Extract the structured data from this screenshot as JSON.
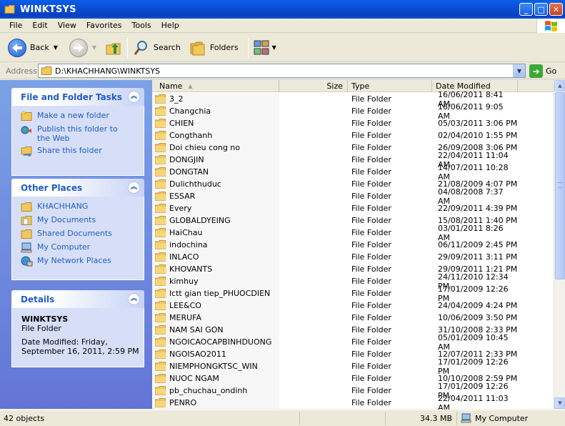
{
  "window": {
    "title": "WINKTSYS",
    "buttons": {
      "minimize": "_",
      "maximize": "□",
      "close": "✕"
    }
  },
  "menu": {
    "items": [
      "File",
      "Edit",
      "View",
      "Favorites",
      "Tools",
      "Help"
    ]
  },
  "toolbar": {
    "back_label": "Back",
    "search_label": "Search",
    "folders_label": "Folders"
  },
  "address": {
    "label": "Address",
    "value": "D:\\KHACHHANG\\WINKTSYS",
    "go_label": "Go"
  },
  "left_pane": {
    "file_tasks": {
      "title": "File and Folder Tasks",
      "items": [
        {
          "label": "Make a new folder",
          "icon": "new-folder-icon"
        },
        {
          "label": "Publish this folder to the Web",
          "icon": "publish-web-icon"
        },
        {
          "label": "Share this folder",
          "icon": "share-folder-icon"
        }
      ]
    },
    "other_places": {
      "title": "Other Places",
      "items": [
        {
          "label": "KHACHHANG",
          "icon": "folder-icon"
        },
        {
          "label": "My Documents",
          "icon": "my-documents-icon"
        },
        {
          "label": "Shared Documents",
          "icon": "shared-documents-icon"
        },
        {
          "label": "My Computer",
          "icon": "my-computer-icon"
        },
        {
          "label": "My Network Places",
          "icon": "network-places-icon"
        }
      ]
    },
    "details": {
      "title": "Details",
      "name": "WINKTSYS",
      "type": "File Folder",
      "modified_line1": "Date Modified: Friday,",
      "modified_line2": "September 16, 2011, 2:59 PM"
    }
  },
  "columns": {
    "name": "Name",
    "size": "Size",
    "type": "Type",
    "date": "Date Modified"
  },
  "files": [
    {
      "name": "3_2",
      "type": "File Folder",
      "date": "16/06/2011 8:41 AM"
    },
    {
      "name": "Changchia",
      "type": "File Folder",
      "date": "16/06/2011 9:05 AM"
    },
    {
      "name": "CHIEN",
      "type": "File Folder",
      "date": "05/03/2011 3:06 PM"
    },
    {
      "name": "Congthanh",
      "type": "File Folder",
      "date": "02/04/2010 1:55 PM"
    },
    {
      "name": "Doi chieu cong no",
      "type": "File Folder",
      "date": "26/09/2008 3:06 PM"
    },
    {
      "name": "DONGJIN",
      "type": "File Folder",
      "date": "22/04/2011 11:04 AM"
    },
    {
      "name": "DONGTAN",
      "type": "File Folder",
      "date": "14/07/2011 10:28 AM"
    },
    {
      "name": "Dulichthuduc",
      "type": "File Folder",
      "date": "21/08/2009 4:07 PM"
    },
    {
      "name": "ESSAR",
      "type": "File Folder",
      "date": "04/08/2008 7:37 AM"
    },
    {
      "name": "Every",
      "type": "File Folder",
      "date": "22/09/2011 4:39 PM"
    },
    {
      "name": "GLOBALDYEING",
      "type": "File Folder",
      "date": "15/08/2011 1:40 PM"
    },
    {
      "name": "HaiChau",
      "type": "File Folder",
      "date": "03/01/2011 8:26 AM"
    },
    {
      "name": "indochina",
      "type": "File Folder",
      "date": "06/11/2009 2:45 PM"
    },
    {
      "name": "INLACO",
      "type": "File Folder",
      "date": "29/09/2011 3:11 PM"
    },
    {
      "name": "KHOVANTS",
      "type": "File Folder",
      "date": "29/09/2011 1:21 PM"
    },
    {
      "name": "kimhuy",
      "type": "File Folder",
      "date": "24/11/2010 12:34 PM"
    },
    {
      "name": "lctt gian tiep_PHUOCDIEN",
      "type": "File Folder",
      "date": "17/01/2009 12:26 PM"
    },
    {
      "name": "LEE&CO",
      "type": "File Folder",
      "date": "24/04/2009 4:24 PM"
    },
    {
      "name": "MERUFA",
      "type": "File Folder",
      "date": "10/06/2009 3:50 PM"
    },
    {
      "name": "NAM SAI GON",
      "type": "File Folder",
      "date": "31/10/2008 2:33 PM"
    },
    {
      "name": "NGOICAOCAPBINHDUONG",
      "type": "File Folder",
      "date": "05/01/2009 10:45 AM"
    },
    {
      "name": "NGOISAO2011",
      "type": "File Folder",
      "date": "12/07/2011 2:33 PM"
    },
    {
      "name": "NIEMPHONGKTSC_WIN",
      "type": "File Folder",
      "date": "17/01/2009 12:26 PM"
    },
    {
      "name": "NUOC NGAM",
      "type": "File Folder",
      "date": "10/10/2008 2:59 PM"
    },
    {
      "name": "pb_chuchau_ondinh",
      "type": "File Folder",
      "date": "17/01/2009 12:26 PM"
    },
    {
      "name": "PENRO",
      "type": "File Folder",
      "date": "22/04/2011 11:03 AM"
    }
  ],
  "status": {
    "objects": "42 objects",
    "size": "34.3 MB",
    "location": "My Computer"
  },
  "colors": {
    "title_bar": "#0c4fd6",
    "task_pane": "#6f8fe0",
    "link": "#215dc6",
    "folder": "#f2c75c"
  }
}
